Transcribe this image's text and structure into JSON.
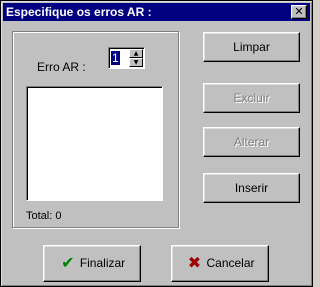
{
  "window": {
    "title": "Especifique os erros AR :",
    "close_symbol": "✕"
  },
  "form": {
    "erro_label": "Erro AR :",
    "erro_value": "1",
    "spin_up_symbol": "▲",
    "spin_down_symbol": "▼",
    "list_items": [],
    "total_label": "Total: 0"
  },
  "actions": {
    "limpar": "Limpar",
    "excluir": "Excluir",
    "alterar": "Alterar",
    "inserir": "Inserir",
    "finalizar": "Finalizar",
    "cancelar": "Cancelar",
    "check_symbol": "✔",
    "x_symbol": "✖"
  },
  "colors": {
    "title_bar": "#000080",
    "face": "#c0c0c0",
    "disabled_text": "#808080",
    "check_icon": "#008000",
    "x_icon": "#a00000"
  }
}
